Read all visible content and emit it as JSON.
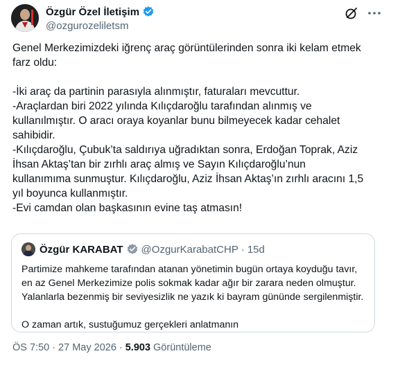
{
  "author": {
    "display_name": "Özgür Özel İletişim",
    "handle": "@ozgurozeliletsm",
    "verified": true,
    "verified_color": "#1d9bf0"
  },
  "header_icons": [
    "grok-icon",
    "more-icon"
  ],
  "body": {
    "intro_line1": "Genel Merkezimizdeki iğrenç araç görüntülerinden sonra iki kelam etmek",
    "intro_line2": "farz oldu:",
    "line1": "-İki araç da partinin parasıyla alınmıştır, faturaları mevcuttur.",
    "line2": "-Araçlardan biri 2022 yılında Kılıçdaroğlu tarafından alınmış ve",
    "line3": "kullanılmıştır. O aracı oraya koyanlar bunu bilmeyecek kadar cehalet",
    "line4": "sahibidir.",
    "line5": "-Kılıçdaroğlu, Çubuk’ta saldırıya uğradıktan sonra, Erdoğan Toprak, Aziz",
    "line6": "İhsan Aktaş’tan bir zırhlı araç almış ve Sayın Kılıçdaroğlu’nun",
    "line7": "kullanımıma sunmuştur. Kılıçdaroğlu, Aziz İhsan Aktaş’ın zırhlı aracını 1,5",
    "line8": "yıl boyunca kullanmıştır.",
    "line9": "-Evi camdan olan başkasının evine taş atmasın!"
  },
  "quote": {
    "display_name": "Özgür KARABAT",
    "handle": "@OzgurKarabatCHP",
    "separator": "·",
    "time": "15d",
    "line1": "Partimize mahkeme tarafından atanan yönetimin bugün ortaya koyduğu tavır,",
    "line2": "en az Genel Merkezimize polis sokmak kadar ağır bir zarara neden olmuştur.",
    "line3": "Yalanlarla bezenmiş bir seviyesizlik ne yazık ki bayram gününde sergilenmiştir.",
    "line4": "O zaman artık, sustuğumuz gerçekleri anlatmanın"
  },
  "meta": {
    "time": "ÖS 7:50",
    "separator": "·",
    "date": "27 May 2026",
    "separator2": "·",
    "views_count": "5.903",
    "views_label": "Görüntüleme"
  }
}
